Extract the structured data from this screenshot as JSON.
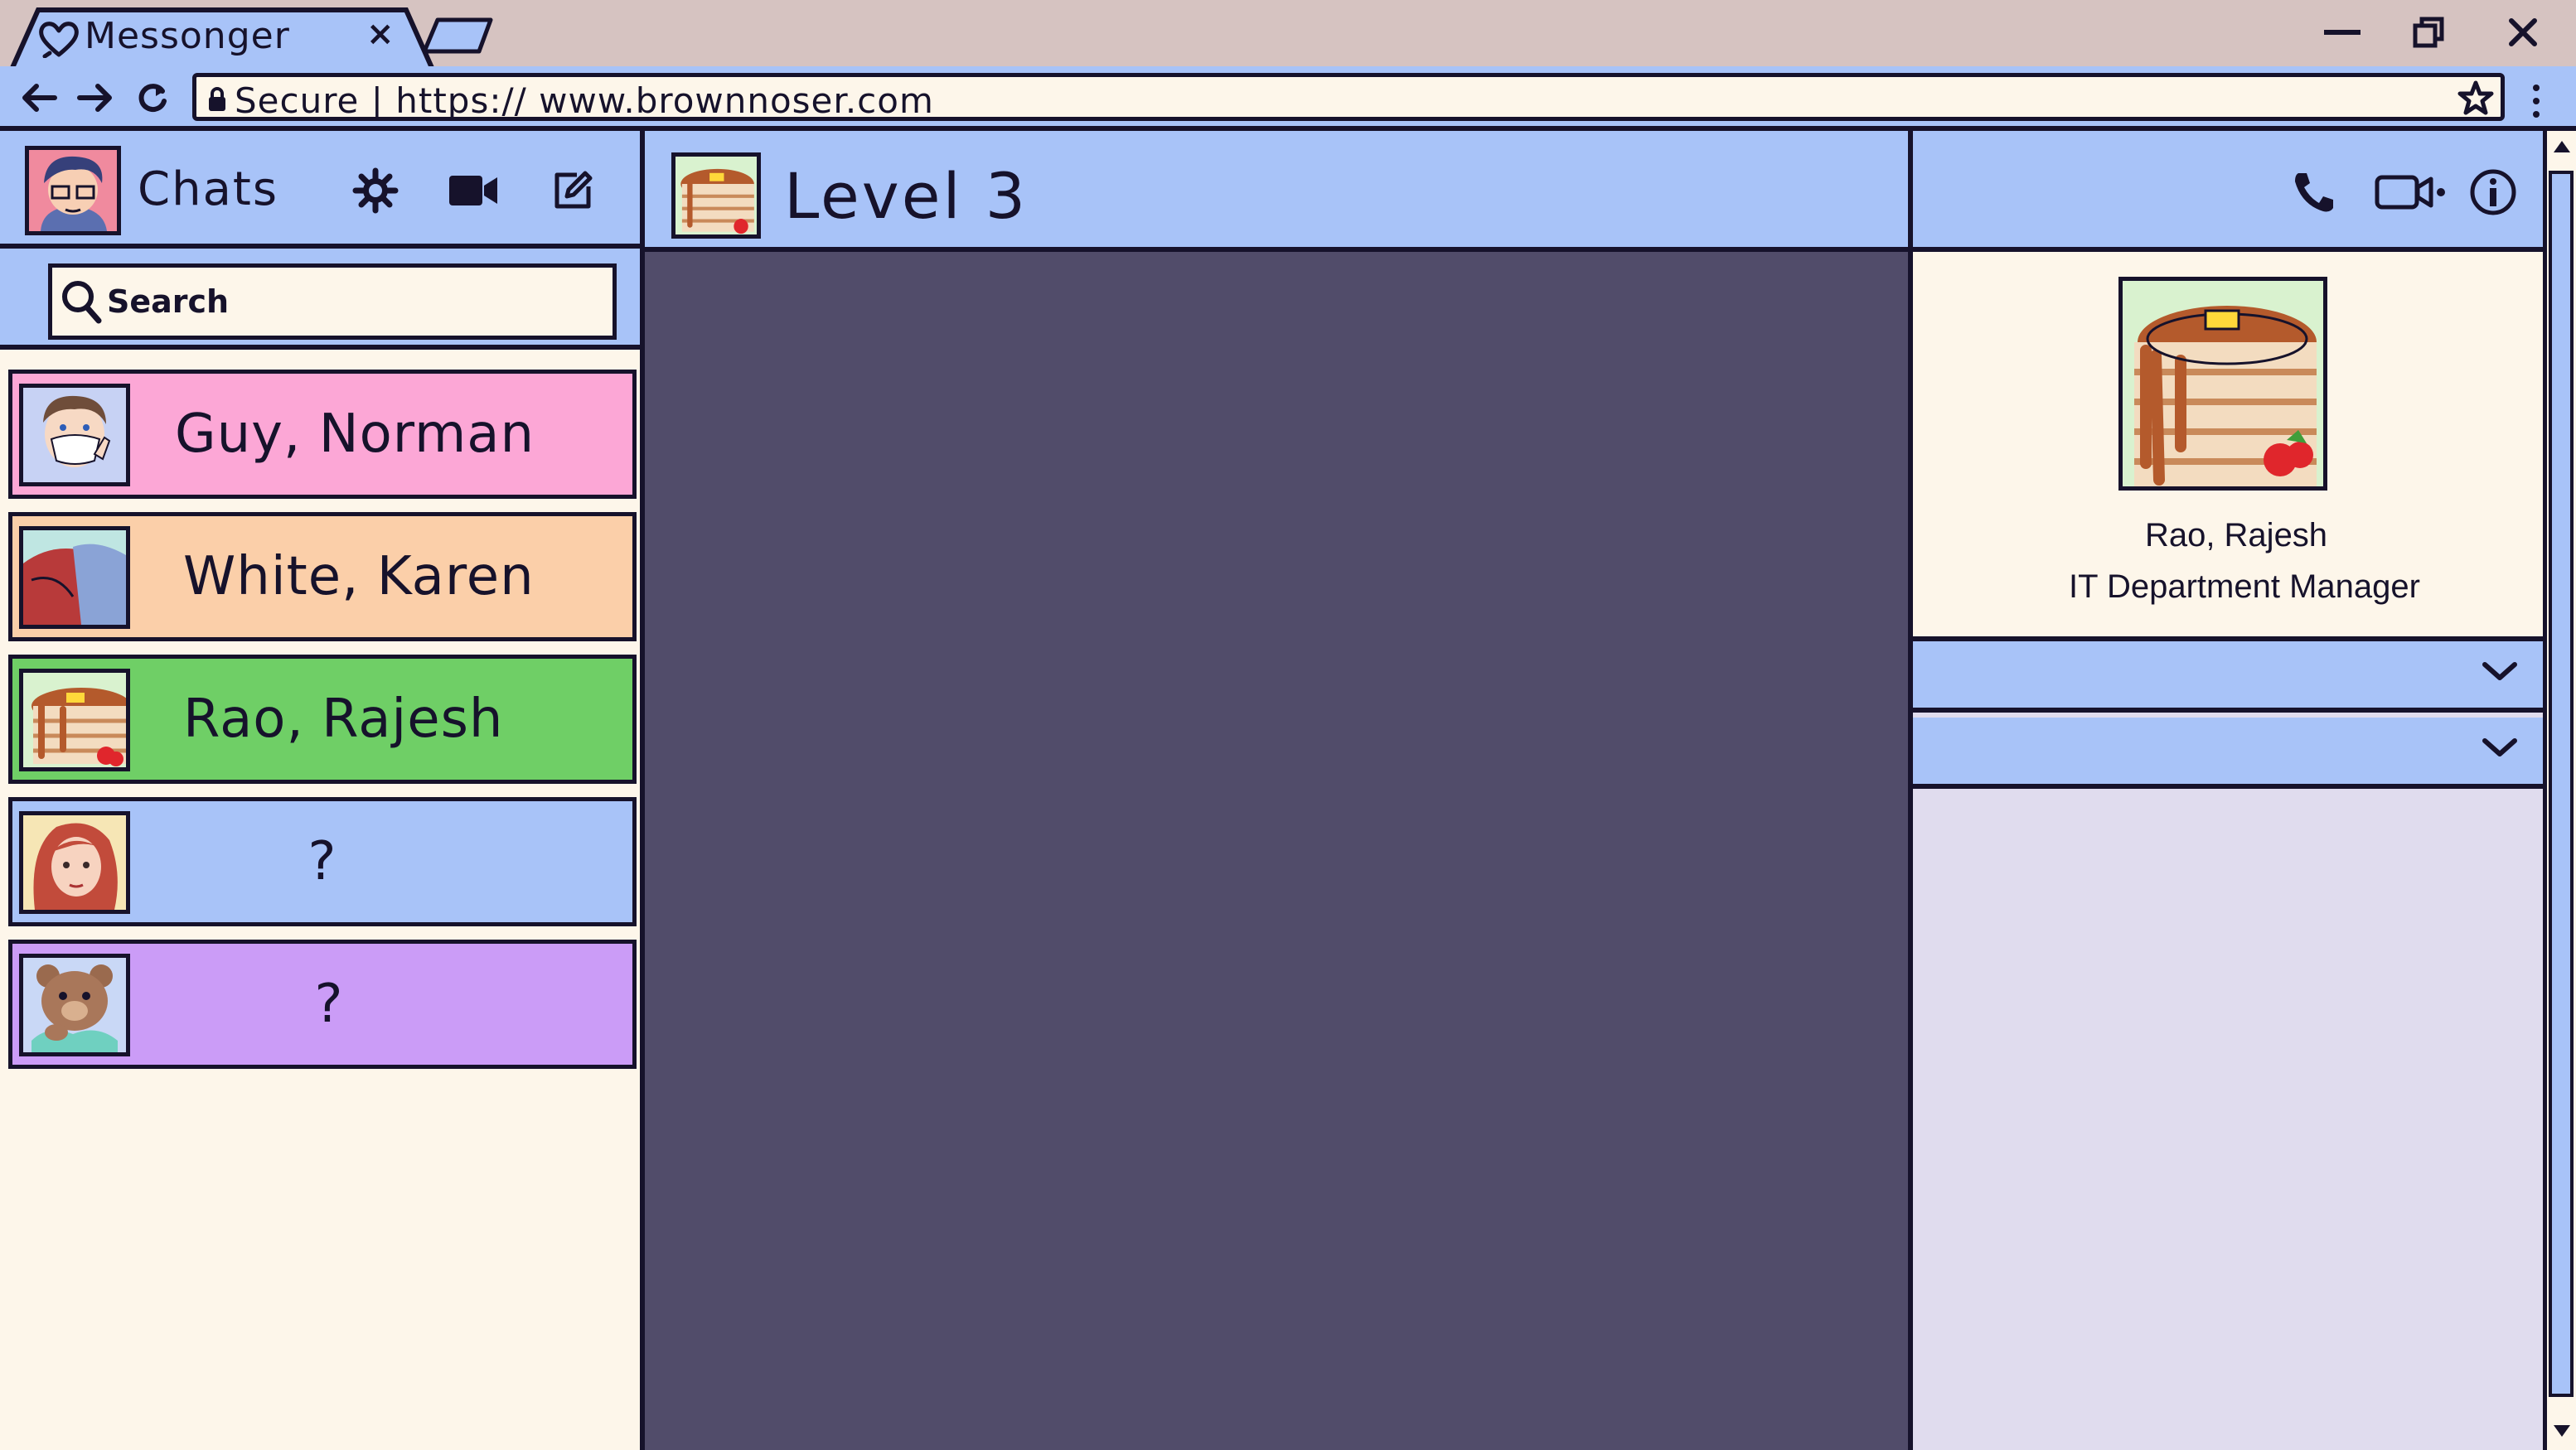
{
  "browser": {
    "tab_title": "Messonger",
    "tab_close": "×",
    "address": "Secure | https:// www.brownnoser.com"
  },
  "sidebar": {
    "title": "Chats",
    "search_placeholder": "Search",
    "contacts": [
      {
        "name": "Guy, Norman",
        "color": "#fca7d6",
        "avatar": "masked-man"
      },
      {
        "name": "White, Karen",
        "color": "#fbcfa9",
        "avatar": "red-haired-woman"
      },
      {
        "name": "Rao, Rajesh",
        "color": "#6fcf66",
        "avatar": "pancakes"
      },
      {
        "name": "?",
        "color": "#a8c3f8",
        "avatar": "red-haired-girl"
      },
      {
        "name": "?",
        "color": "#cb9cf7",
        "avatar": "teddy-bear"
      }
    ]
  },
  "conversation": {
    "title": "Level 3",
    "avatar": "pancakes"
  },
  "details": {
    "name": "Rao, Rajesh",
    "role": "IT Department Manager",
    "avatar": "pancakes"
  },
  "colors": {
    "ink": "#16122b",
    "header_blue": "#a8c3f8",
    "chat_bg": "#514c6a",
    "panel_cream": "#fdf6ea",
    "panel_lavender": "#e0dcee",
    "titlebar": "#d6c3c1"
  }
}
